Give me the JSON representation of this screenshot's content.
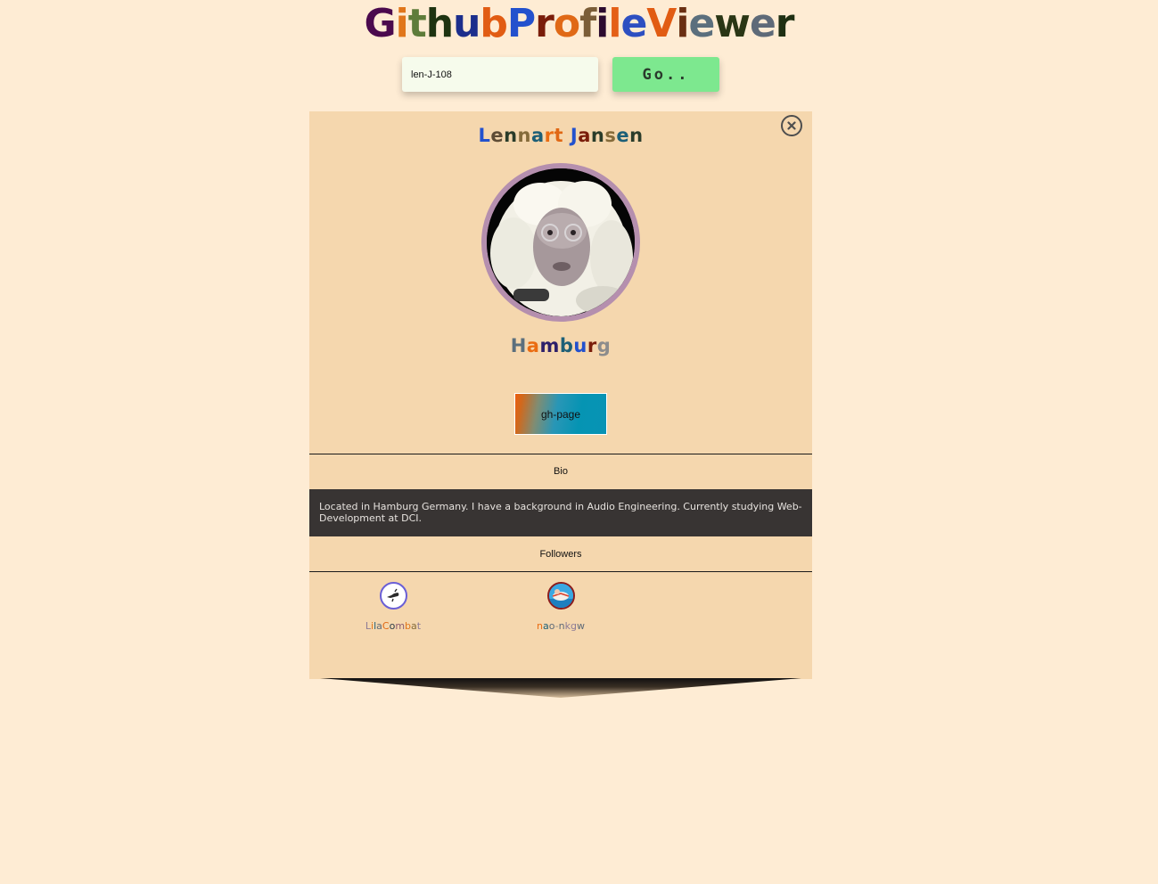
{
  "app": {
    "title": "GithubProfileViewer",
    "title_colors": [
      "#4b0a4e",
      "#e0761b",
      "#5e7c3a",
      "#1e3310",
      "#1c2e8c",
      "#e15c13",
      "#2351cd",
      "#7a1d0a",
      "#e06916",
      "#7b5d37",
      "#2c0a2e",
      "#e45f16",
      "#2d4fc1",
      "#e15c13",
      "#6a2f12",
      "#5b6f7d",
      "#2a3615",
      "#5e6a78",
      "#1e2f12"
    ]
  },
  "search": {
    "value": "len-J-108",
    "button_label": "Go.."
  },
  "profile": {
    "name": "Lennart Jansen",
    "name_colors": [
      "#2351cd",
      "#5e4c35",
      "#2a3c2a",
      "#856b3a",
      "#1d5f77",
      "#ea6c12",
      "#e06714",
      "#2351cd",
      "#7a1d0a",
      "#2a3c2a",
      "#856b3a",
      "#1d5f77",
      "#2a3c2a",
      "#5e6a78"
    ],
    "location": "Hamburg",
    "location_colors": [
      "#5b6f7d",
      "#ea6c12",
      "#2d1f6a",
      "#1d5f77",
      "#2351cd",
      "#7a1d0a",
      "#8c8c8c"
    ],
    "gh_page_label": "gh-page",
    "bio_label": "Bio",
    "bio": "Located in Hamburg Germany. I have a background in Audio Engineering. Currently studying Web-Development at DCI.",
    "followers_label": "Followers"
  },
  "followers": [
    {
      "login": "LilaCombat",
      "colors": [
        "#8c7b96",
        "#e0761b",
        "#1d5f77",
        "#5e6a78",
        "#e06916",
        "#2c3c48",
        "#8c5b6f",
        "#e0761b",
        "#856b3a",
        "#8c7b96"
      ]
    },
    {
      "login": "nao-nkgw",
      "colors": [
        "#ea6c12",
        "#1d5f77",
        "#5e6a78",
        "#8c8c8c",
        "#5e6a78",
        "#8c7b96",
        "#8c7b96",
        "#5e6a78"
      ]
    }
  ],
  "icons": {
    "close": "close-circle-icon"
  }
}
